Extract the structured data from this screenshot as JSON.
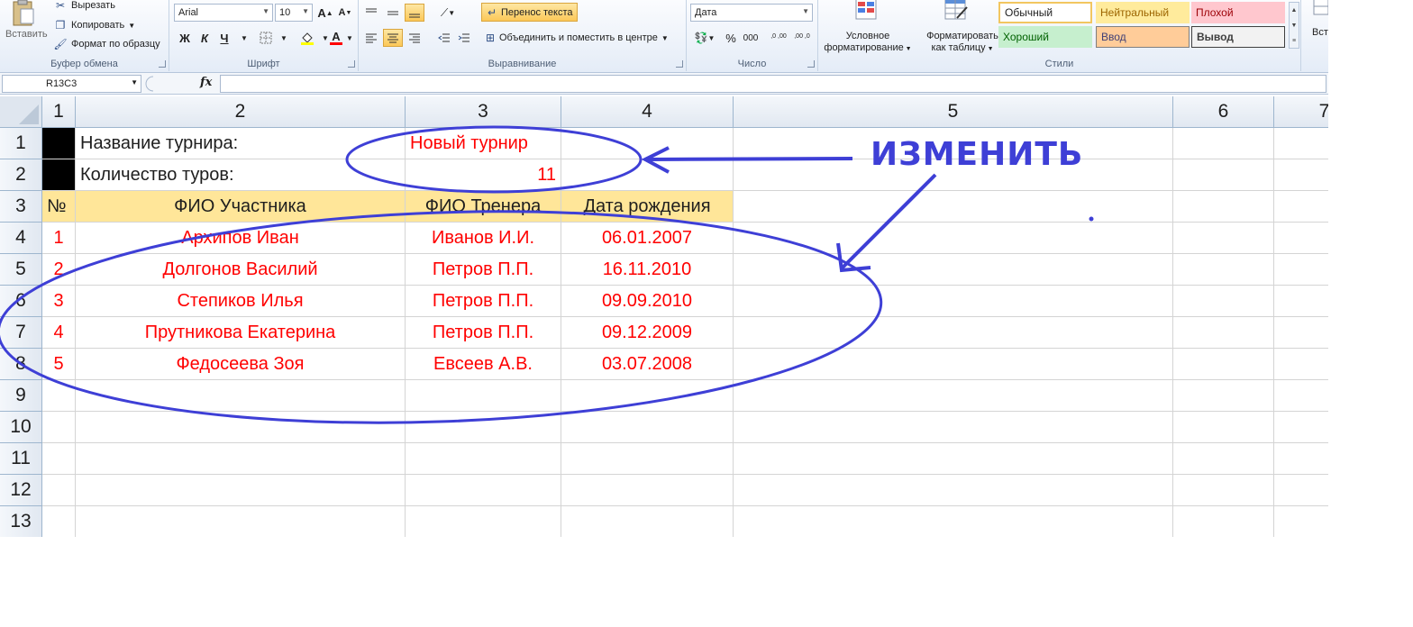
{
  "ribbon": {
    "clipboard": {
      "paste_label": "Вставить",
      "cut_label": "Вырезать",
      "copy_label": "Копировать",
      "format_painter_label": "Формат по образцу",
      "group_label": "Буфер обмена"
    },
    "font": {
      "font_name": "Arial",
      "font_size": "10",
      "bold": "Ж",
      "italic": "К",
      "underline": "Ч",
      "grow": "A",
      "shrink": "A",
      "fill_letter": "A",
      "group_label": "Шрифт"
    },
    "alignment": {
      "wrap_text_label": "Перенос текста",
      "merge_center_label": "Объединить и поместить в центре",
      "group_label": "Выравнивание"
    },
    "number": {
      "format_value": "Дата",
      "percent": "%",
      "thousands": "000",
      "inc_decimal": ",0 ,00",
      "dec_decimal": ",00 ,0",
      "group_label": "Число"
    },
    "styles": {
      "conditional_label_1": "Условное",
      "conditional_label_2": "форматирование",
      "as_table_label_1": "Форматировать",
      "as_table_label_2": "как таблицу",
      "normal": "Обычный",
      "neutral": "Нейтральный",
      "bad": "Плохой",
      "good": "Хороший",
      "input": "Ввод",
      "output": "Вывод",
      "group_label": "Стили"
    },
    "cells": {
      "insert_label": "Вст"
    }
  },
  "formula_bar": {
    "name_box": "R13C3",
    "fx": "fx",
    "formula": ""
  },
  "columns": [
    "1",
    "2",
    "3",
    "4",
    "5",
    "6",
    "7"
  ],
  "rows": [
    "1",
    "2",
    "3",
    "4",
    "5",
    "6",
    "7",
    "8",
    "9",
    "10",
    "11",
    "12",
    "13"
  ],
  "sheet": {
    "tournament_label": "Название турнира:",
    "tournament_value": "Новый турнир",
    "rounds_label": "Количество туров:",
    "rounds_value": "11",
    "headers": {
      "num": "№",
      "participant": "ФИО Участника",
      "coach": "ФИО Тренера",
      "birth": "Дата рождения"
    },
    "participants": [
      {
        "num": "1",
        "name": "Архипов Иван",
        "coach": "Иванов И.И.",
        "birth": "06.01.2007"
      },
      {
        "num": "2",
        "name": "Долгонов Василий",
        "coach": "Петров П.П.",
        "birth": "16.11.2010"
      },
      {
        "num": "3",
        "name": "Степиков Илья",
        "coach": "Петров П.П.",
        "birth": "09.09.2010"
      },
      {
        "num": "4",
        "name": "Прутникова Екатерина",
        "coach": "Петров П.П.",
        "birth": "09.12.2009"
      },
      {
        "num": "5",
        "name": "Федосеева Зоя",
        "coach": "Евсеев А.В.",
        "birth": "03.07.2008"
      }
    ]
  },
  "annotation": {
    "label": "ИЗМЕНИТЬ",
    "color": "#3e3fd6"
  },
  "colors": {
    "value_text": "#ff0000",
    "header_fill": "#ffe699",
    "gridline": "#d4d4d4"
  }
}
